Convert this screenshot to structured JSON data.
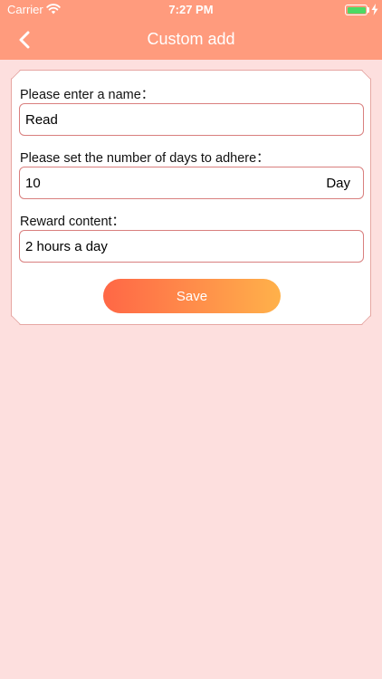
{
  "status_bar": {
    "carrier": "Carrier",
    "time": "7:27 PM",
    "battery_color": "#4CD964"
  },
  "nav": {
    "title": "Custom add",
    "back_icon": "chevron-left-icon"
  },
  "form": {
    "name_label": "Please enter a name：",
    "name_value": "Read",
    "days_label": "Please set the number of days to adhere：",
    "days_value": "10",
    "days_unit": "Day",
    "reward_label": "Reward content：",
    "reward_value": "2 hours a day",
    "save_label": "Save"
  },
  "colors": {
    "header": "#FF9B7D",
    "background": "#FDDFDE",
    "field_border": "#D97F7E",
    "button_start": "#FF6746",
    "button_end": "#FFB14A"
  }
}
